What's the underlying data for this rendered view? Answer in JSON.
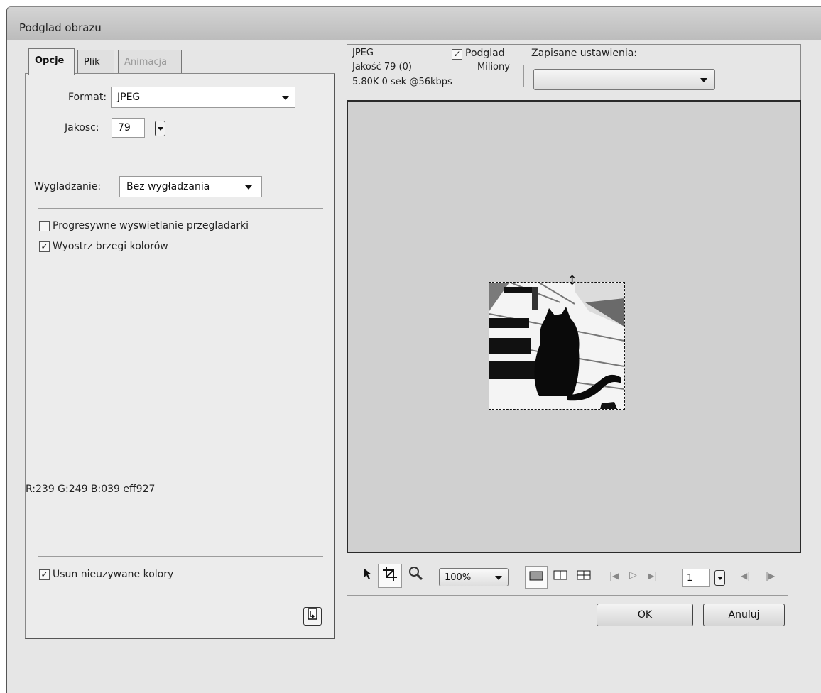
{
  "window": {
    "title": "Podglad obrazu"
  },
  "tabs": [
    {
      "label": "Opcje",
      "active": true
    },
    {
      "label": "Plik",
      "active": false
    },
    {
      "label": "Animacja",
      "disabled": true
    }
  ],
  "options": {
    "format_label": "Format:",
    "format_value": "JPEG",
    "quality_label": "Jakosc:",
    "quality_value": "79",
    "smoothing_label": "Wygladzanie:",
    "smoothing_value": "Bez wygładzania",
    "progressive_label": "Progresywne wyswietlanie przegladarki",
    "progressive_checked": false,
    "sharpen_label": "Wyostrz brzegi kolorów",
    "sharpen_checked": true,
    "color_readout": "R:239 G:249 B:039 eff927",
    "remove_unused_label": "Usun nieuzywane kolory",
    "remove_unused_checked": true,
    "panel_icon": "export-icon"
  },
  "preview_info": {
    "format": "JPEG",
    "quality_text": "Jakość 79 (0)",
    "size_text": "5.80K  0 sek @56kbps",
    "preview_label": "Podglad",
    "preview_checked": true,
    "colors_text": "Miliony",
    "saved_settings_label": "Zapisane ustawienia:",
    "saved_settings_value": ""
  },
  "toolbar": {
    "zoom": "100%",
    "frame": "1",
    "icons": [
      "pointer-icon",
      "crop-icon",
      "zoom-icon",
      "single-view-icon",
      "two-up-view-icon",
      "four-up-view-icon",
      "first-frame-icon",
      "play-icon",
      "last-frame-icon",
      "prev-frame-icon",
      "next-frame-icon"
    ]
  },
  "buttons": {
    "ok": "OK",
    "cancel": "Anuluj"
  },
  "check_mark": "✓"
}
